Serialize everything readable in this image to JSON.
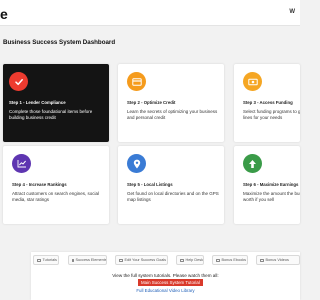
{
  "header": {
    "logo": "e",
    "right_text": "W"
  },
  "page_title": "Business Success System Dashboard",
  "colors": {
    "red": "#ed3b2f",
    "orange": "#f59b1c",
    "yellow": "#f5a623",
    "purple": "#5e35b1",
    "blue": "#3a7bd5",
    "green": "#3a9b48"
  },
  "cards": [
    {
      "title": "Step 1 - Lender Compliance",
      "desc": "Complete those foundational items before building business credit",
      "icon": "check-icon",
      "color": "#ed3b2f",
      "dark": true
    },
    {
      "title": "Step 2 - Optimize Credit",
      "desc": "Learn the secrets of optimizing your business and personal credit",
      "icon": "credit-card-icon",
      "color": "#f59b1c"
    },
    {
      "title": "Step 3 - Access Funding",
      "desc": "Select funding programs to get credit lines for your needs",
      "icon": "money-icon",
      "color": "#f5a623"
    },
    {
      "title": "Step 4 - Increase Rankings",
      "desc": "Attract customers on search engines, social media, star ratings",
      "icon": "chart-trend-icon",
      "color": "#5e35b1"
    },
    {
      "title": "Step 5 - Local Listings",
      "desc": "Get found on local directories and on the GPS map listings",
      "icon": "map-pin-icon",
      "color": "#3a7bd5"
    },
    {
      "title": "Step 6 - Maximize Earnings",
      "desc": "Maximize the amount the business is worth if you sell",
      "icon": "arrow-up-icon",
      "color": "#3a9b48"
    }
  ],
  "tabs": [
    "Tutorials",
    "Success Elements",
    "Edit Your Success Goals",
    "Help Desk",
    "Bonus Ebooks",
    "Bonus Videos"
  ],
  "tutorials": {
    "info": "View the full system tutorials. Please watch them all:",
    "main_button": "Main Success System Tutorial",
    "library_link": "Full Educational Video Library"
  }
}
